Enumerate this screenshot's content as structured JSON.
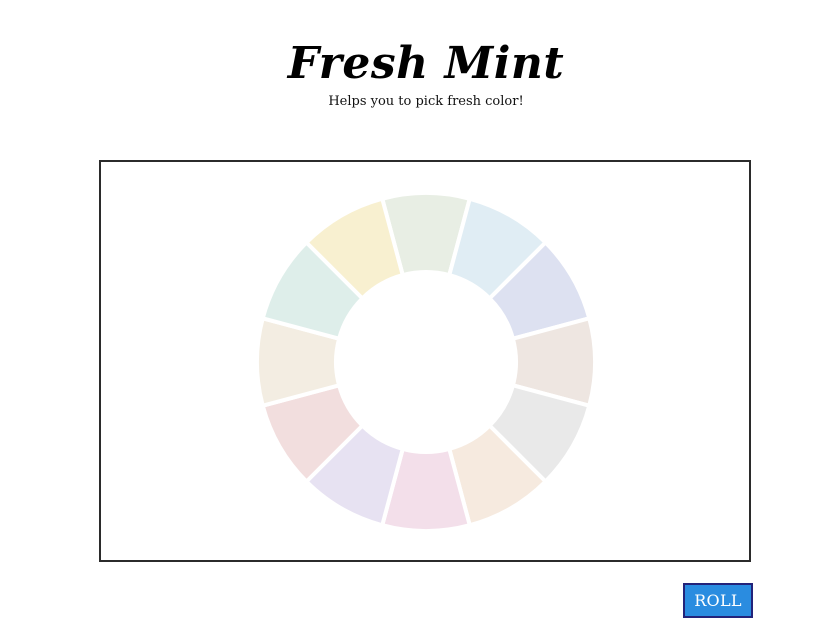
{
  "app": {
    "title": "Fresh Mint",
    "subtitle": "Helps you to pick fresh color!"
  },
  "wheel": {
    "colors": [
      "#e8eee4",
      "#e0edf4",
      "#dde1f1",
      "#eee6e1",
      "#e9e9e9",
      "#f6eadf",
      "#f3dfea",
      "#e7e2f2",
      "#f2dede",
      "#f3ede2",
      "#deeeea",
      "#f8f0d0"
    ]
  },
  "controls": {
    "roll_label": "ROLL"
  }
}
